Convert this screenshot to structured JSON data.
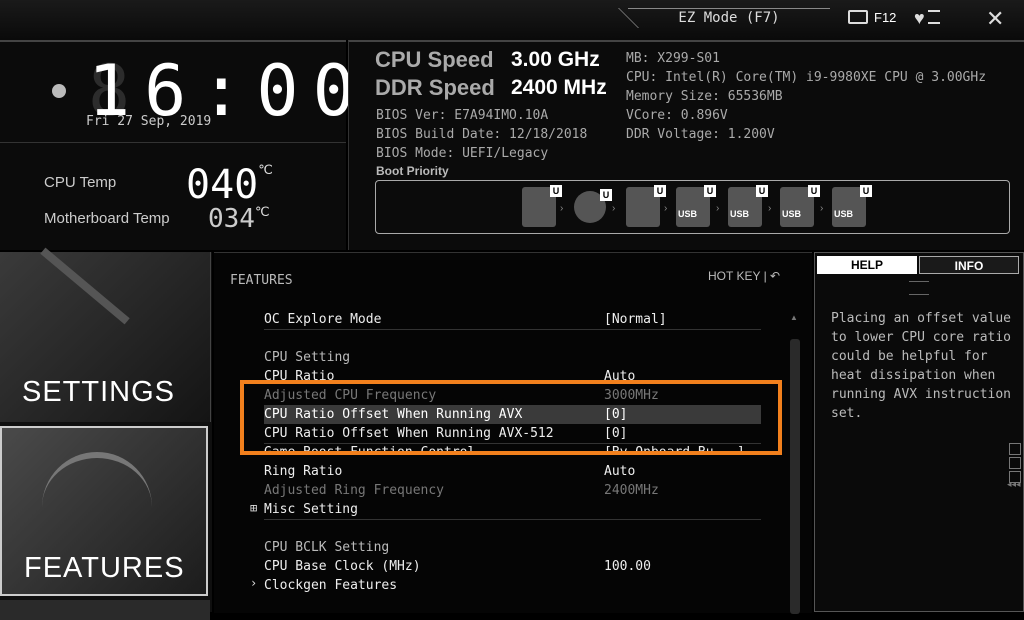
{
  "topbar": {
    "ez_mode": "EZ Mode (F7)",
    "f12": "F12",
    "close": "✕"
  },
  "clock": {
    "time": "16:00",
    "date": "Fri  27 Sep, 2019"
  },
  "temps": {
    "cpu_label": "CPU Temp",
    "cpu_value": "40",
    "cpu_unit": "℃",
    "mb_label": "Motherboard Temp",
    "mb_value": "34",
    "mb_unit": "℃"
  },
  "speeds": {
    "cpu_label": "CPU Speed",
    "cpu_value": "3.00 GHz",
    "ddr_label": "DDR Speed",
    "ddr_value": "2400 MHz"
  },
  "bios": {
    "ver": "BIOS Ver: E7A94IMO.10A",
    "build": "BIOS Build Date: 12/18/2018",
    "mode": "BIOS Mode: UEFI/Legacy",
    "boot_priority": "Boot Priority"
  },
  "sysinfo": {
    "mb": "MB: X299-S01",
    "cpu": "CPU: Intel(R) Core(TM) i9-9980XE CPU @ 3.00GHz",
    "mem": "Memory Size: 65536MB",
    "vcore": "VCore: 0.896V",
    "ddr_v": "DDR Voltage: 1.200V"
  },
  "boot_devices": [
    {
      "icon": "hdd-icon",
      "badge": "U",
      "label": ""
    },
    {
      "icon": "optical-disc-icon",
      "badge": "U",
      "label": ""
    },
    {
      "icon": "network-icon",
      "badge": "U",
      "label": ""
    },
    {
      "icon": "usb-hdd-icon",
      "badge": "U",
      "label": "USB"
    },
    {
      "icon": "usb-cd-icon",
      "badge": "U",
      "label": "USB"
    },
    {
      "icon": "usb-key-icon",
      "badge": "U",
      "label": "USB"
    },
    {
      "icon": "usb-floppy-icon",
      "badge": "U",
      "label": "USB"
    }
  ],
  "nav": {
    "settings": "SETTINGS",
    "features": "FEATURES"
  },
  "main": {
    "title": "FEATURES",
    "hotkey": "HOT KEY  |  ↶",
    "rows": [
      {
        "key": "OC Explore Mode",
        "value": "[Normal]"
      },
      {
        "key": "CPU Setting",
        "value": ""
      },
      {
        "key": "CPU Ratio",
        "value": "Auto"
      },
      {
        "key": "Adjusted CPU Frequency",
        "value": "3000MHz"
      },
      {
        "key": "CPU Ratio Offset When Running AVX",
        "value": "[0]"
      },
      {
        "key": "CPU Ratio Offset When Running AVX-512",
        "value": "[0]"
      },
      {
        "key": "Game Boost Function Control",
        "value": "[By Onboard Bu...]"
      },
      {
        "key": "Ring Ratio",
        "value": "Auto"
      },
      {
        "key": "Adjusted Ring Frequency",
        "value": "2400MHz"
      },
      {
        "key": "Misc Setting",
        "value": ""
      },
      {
        "key": "CPU BCLK Setting",
        "value": ""
      },
      {
        "key": "CPU Base Clock (MHz)",
        "value": "100.00"
      },
      {
        "key": "Clockgen Features",
        "value": ""
      }
    ]
  },
  "help": {
    "tab_help": "HELP",
    "tab_info": "INFO",
    "text": "Placing an offset value to lower CPU core ratio could be helpful for heat dissipation when running AVX instruction set."
  },
  "colors": {
    "highlight": "#f2801d"
  }
}
